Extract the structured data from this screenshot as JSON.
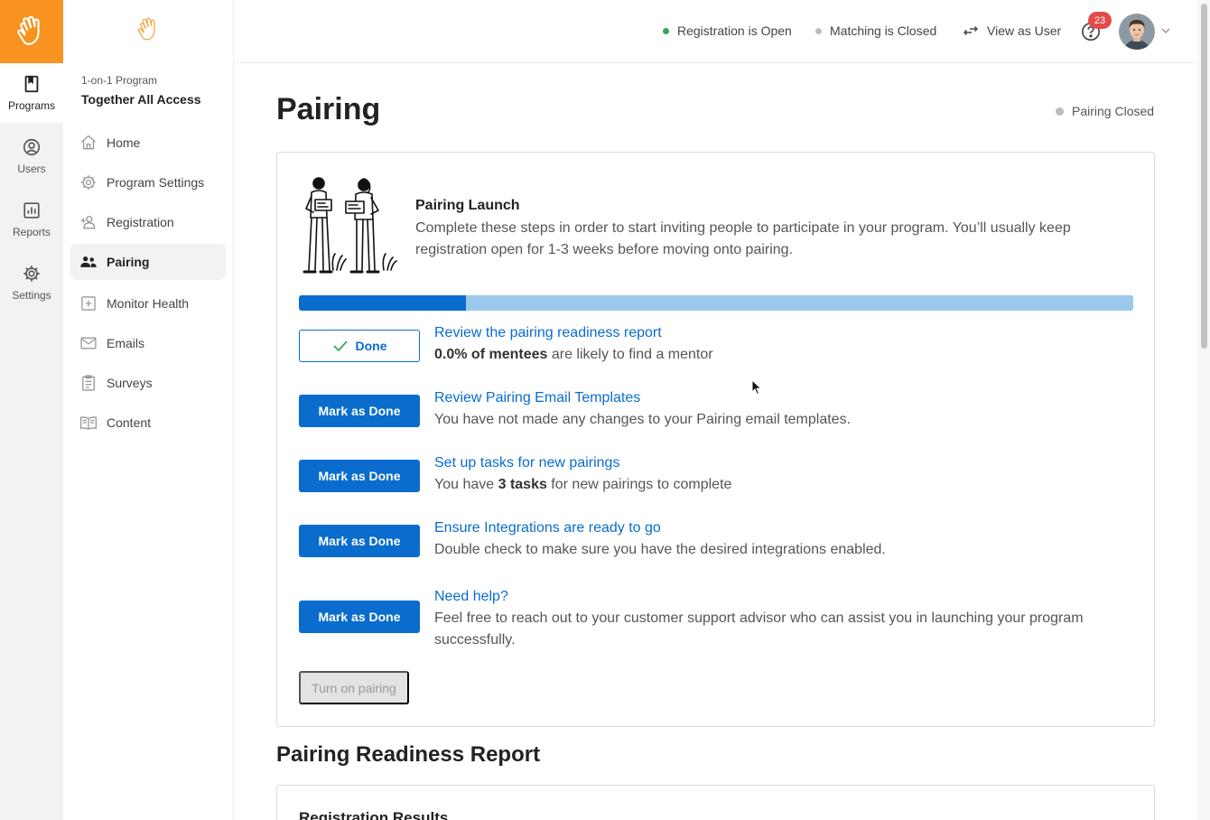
{
  "rail": {
    "items": [
      {
        "label": "Programs",
        "icon": "bookmark-icon"
      },
      {
        "label": "Users",
        "icon": "user-circle-icon"
      },
      {
        "label": "Reports",
        "icon": "bar-chart-icon"
      },
      {
        "label": "Settings",
        "icon": "gear-icon"
      }
    ]
  },
  "sidebar": {
    "program_type": "1-on-1 Program",
    "program_name": "Together All Access",
    "items": [
      {
        "label": "Home",
        "icon": "home-icon"
      },
      {
        "label": "Program Settings",
        "icon": "gear-icon"
      },
      {
        "label": "Registration",
        "icon": "add-user-icon"
      },
      {
        "label": "Pairing",
        "icon": "users-icon"
      },
      {
        "label": "Monitor Health",
        "icon": "health-cross-icon"
      },
      {
        "label": "Emails",
        "icon": "mail-icon"
      },
      {
        "label": "Surveys",
        "icon": "clipboard-icon"
      },
      {
        "label": "Content",
        "icon": "book-icon"
      }
    ]
  },
  "header": {
    "registration_status": "Registration is Open",
    "matching_status": "Matching is Closed",
    "view_as_user": "View as User",
    "notification_count": "23"
  },
  "main": {
    "title": "Pairing",
    "pairing_status": "Pairing Closed",
    "launch": {
      "title": "Pairing Launch",
      "description": "Complete these steps in order to start inviting people to participate in your program. You’ll usually keep registration open for 1-3 weeks before moving onto pairing.",
      "progress_fraction": 0.2,
      "steps": [
        {
          "button": "Done",
          "state": "done",
          "link": "Review the pairing readiness report",
          "text_bold": "0.0% of mentees",
          "text_rest": " are likely to find a mentor"
        },
        {
          "button": "Mark as Done",
          "state": "todo",
          "link": "Review Pairing Email Templates",
          "text_rest": "You have not made any changes to your Pairing email templates."
        },
        {
          "button": "Mark as Done",
          "state": "todo",
          "link": "Set up tasks for new pairings",
          "text_pre": "You have ",
          "text_bold": "3 tasks",
          "text_rest": " for new pairings to complete"
        },
        {
          "button": "Mark as Done",
          "state": "todo",
          "link": "Ensure Integrations are ready to go",
          "text_rest": "Double check to make sure you have the desired integrations enabled."
        },
        {
          "button": "Mark as Done",
          "state": "todo",
          "link": "Need help?",
          "text_rest": "Feel free to reach out to your customer support advisor who can assist you in launching your program successfully."
        }
      ],
      "turn_on_label": "Turn on pairing"
    },
    "readiness_title": "Pairing Readiness Report",
    "registration_results_title": "Registration Results"
  },
  "colors": {
    "brand_orange": "#f7931e",
    "primary_blue": "#0a6ccc",
    "progress_track": "#9cc8ee",
    "status_open": "#3aa65a",
    "status_closed": "#bdbdbd",
    "badge_red": "#e34b4b"
  }
}
